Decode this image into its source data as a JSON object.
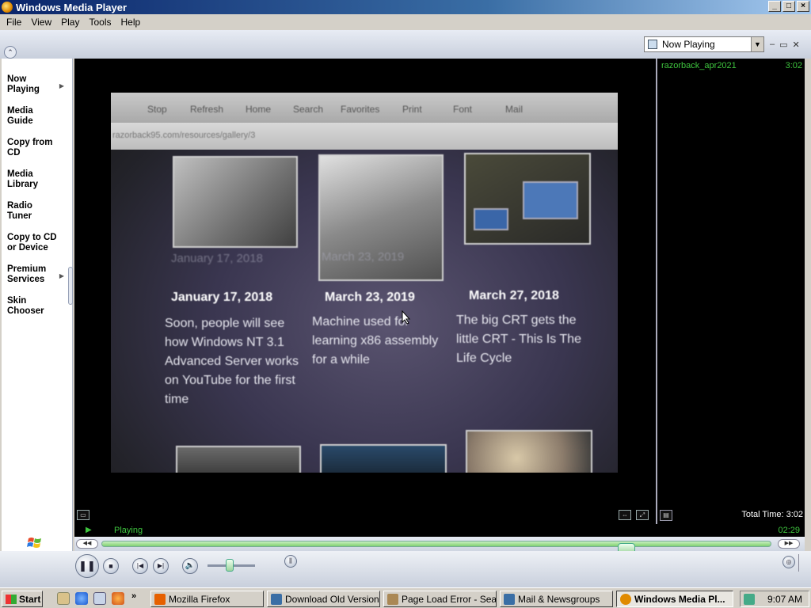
{
  "window": {
    "title": "Windows Media Player"
  },
  "menu": [
    "File",
    "View",
    "Play",
    "Tools",
    "Help"
  ],
  "now_playing_select": {
    "value": "Now Playing"
  },
  "sidebar": {
    "items": [
      {
        "label_1": "Now",
        "label_2": "Playing",
        "has_arrow": true
      },
      {
        "label_1": "Media",
        "label_2": "Guide"
      },
      {
        "label_1": "Copy from",
        "label_2": "CD"
      },
      {
        "label_1": "Media",
        "label_2": "Library"
      },
      {
        "label_1": "Radio",
        "label_2": "Tuner"
      },
      {
        "label_1": "Copy to CD",
        "label_2": "or Device"
      },
      {
        "label_1": "Premium",
        "label_2": "Services",
        "has_arrow": true
      },
      {
        "label_1": "Skin",
        "label_2": "Chooser"
      }
    ]
  },
  "video": {
    "toolbar": [
      "Stop",
      "Refresh",
      "Home",
      "Search",
      "Favorites",
      "Print",
      "Font",
      "Mail"
    ],
    "address": "razorback95.com/resources/gallery/3",
    "cards": [
      {
        "date": "January 17, 2018",
        "caption": "Soon, people will see how Windows NT 3.1 Advanced Server works on YouTube for the first time",
        "ghost_date": "January 17, 2018"
      },
      {
        "date": "March 23, 2019",
        "caption": "Machine used for learning x86 assembly for a while",
        "ghost_date": "March 23, 2019"
      },
      {
        "date": "March 27, 2018",
        "caption": "The big CRT gets the little CRT - This Is The Life Cycle"
      }
    ]
  },
  "playlist": {
    "items": [
      {
        "name": "razorback_apr2021",
        "duration": "3:02"
      }
    ],
    "total_time": "Total Time: 3:02"
  },
  "status": {
    "text": "Playing",
    "time": "02:29"
  },
  "playback": {
    "progress": 0.79,
    "volume": 0.45
  },
  "taskbar": {
    "start": "Start",
    "tasks": [
      {
        "label": "Mozilla Firefox",
        "icon_color": "#e66000"
      },
      {
        "label": "Download Old Versions...",
        "icon_color": "#3a6ea5"
      },
      {
        "label": "Page Load Error - Sea...",
        "icon_color": "#a85"
      },
      {
        "label": "Mail & Newsgroups",
        "icon_color": "#3a6ea5"
      },
      {
        "label": "Windows Media Pl...",
        "icon_color": "#e08a00"
      }
    ],
    "clock": "9:07 AM"
  }
}
